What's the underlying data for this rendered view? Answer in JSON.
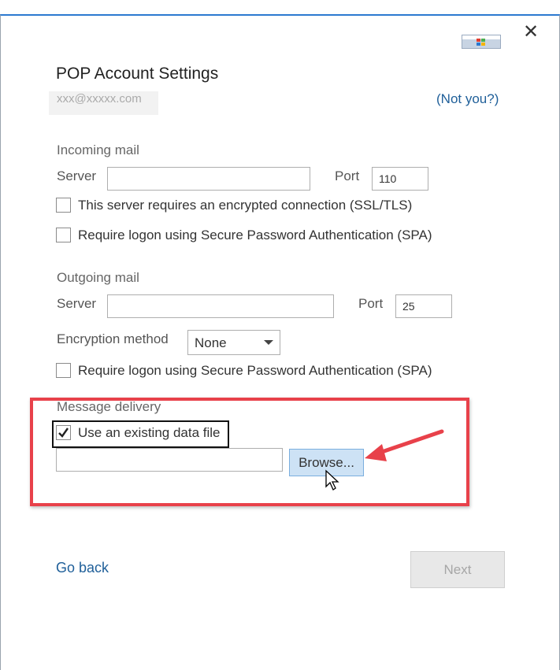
{
  "dialog": {
    "title": "POP Account Settings",
    "email": "xxx@xxxxx.com",
    "not_you_link": "(Not you?)",
    "close_glyph": "✕"
  },
  "incoming": {
    "section_label": "Incoming mail",
    "server_label": "Server",
    "server_value": "",
    "port_label": "Port",
    "port_value": "110",
    "ssl_checkbox_label": "This server requires an encrypted connection (SSL/TLS)",
    "ssl_checked": false,
    "spa_checkbox_label": "Require logon using Secure Password Authentication (SPA)",
    "spa_checked": false
  },
  "outgoing": {
    "section_label": "Outgoing mail",
    "server_label": "Server",
    "server_value": "",
    "port_label": "Port",
    "port_value": "25",
    "encryption_label": "Encryption method",
    "encryption_value": "None",
    "spa_checkbox_label": "Require logon using Secure Password Authentication (SPA)",
    "spa_checked": false
  },
  "delivery": {
    "section_label": "Message delivery",
    "existing_file_label": "Use an existing data file",
    "existing_file_checked": true,
    "file_path_value": "",
    "browse_label": "Browse..."
  },
  "footer": {
    "go_back_label": "Go back",
    "next_label": "Next"
  },
  "colors": {
    "accent": "#2b79d0",
    "link": "#1f5f99",
    "highlight_red": "#e8414a",
    "browse_bg": "#cde2f5"
  },
  "icons": [
    "close-icon",
    "outlook-logo-icon",
    "checkmark-icon",
    "chevron-down-icon",
    "annotation-arrow-icon",
    "mouse-cursor-icon"
  ]
}
